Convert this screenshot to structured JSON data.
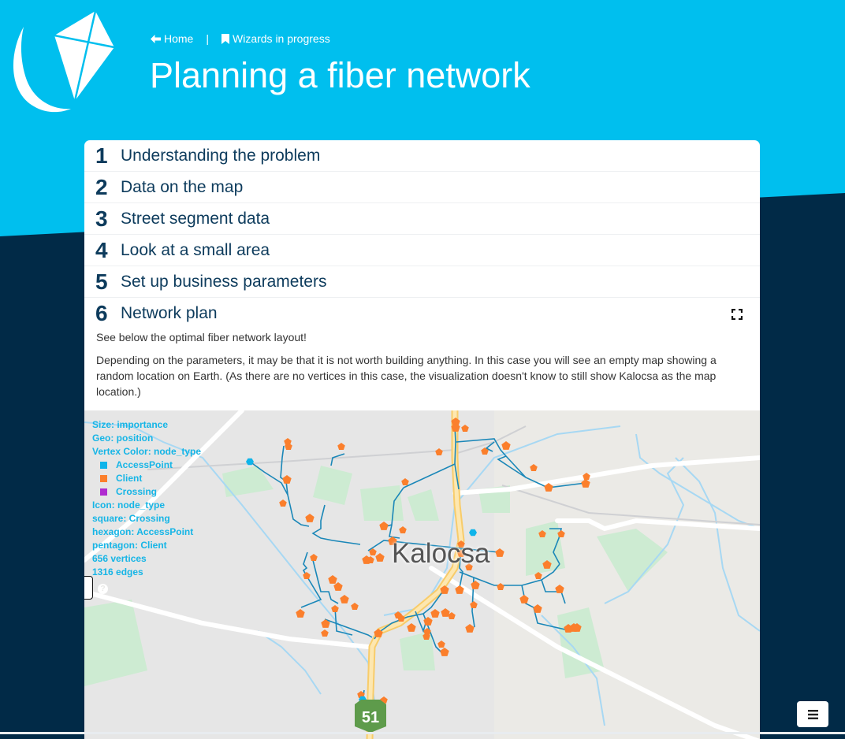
{
  "header": {
    "breadcrumb": {
      "home_label": "Home",
      "home_icon": "arrow-left-icon",
      "separator": "|",
      "wizards_label": "Wizards in progress",
      "wizards_icon": "bookmark-icon"
    },
    "title": "Planning a fiber network",
    "logo": "kite-logo"
  },
  "steps": [
    {
      "number": "1",
      "label": "Understanding the problem"
    },
    {
      "number": "2",
      "label": "Data on the map"
    },
    {
      "number": "3",
      "label": "Street segment data"
    },
    {
      "number": "4",
      "label": "Look at a small area"
    },
    {
      "number": "5",
      "label": "Set up business parameters"
    },
    {
      "number": "6",
      "label": "Network plan"
    }
  ],
  "active_step": {
    "fullscreen_icon": "fullscreen-icon",
    "intro": "See below the optimal fiber network layout!",
    "note": "Depending on the parameters, it may be that it is not worth building anything. In this case you will see an empty map showing a random location on Earth. (As there are no vertices in this case, the visualization doesn't know to still show Kalocsa as the map location.)"
  },
  "map": {
    "city_label": "Kalocsa",
    "road_shield": "51",
    "legend": {
      "size": "Size: importance",
      "geo": "Geo: position",
      "vertex_color": "Vertex Color: node_type",
      "colors": [
        {
          "label": "AccessPoint",
          "color": "#0fb4ea"
        },
        {
          "label": "Client",
          "color": "#fb7f2c"
        },
        {
          "label": "Crossing",
          "color": "#b02cd0"
        }
      ],
      "icon": "Icon: node_type",
      "square": "square: Crossing",
      "hexagon": "hexagon: AccessPoint",
      "pentagon": "pentagon: Client",
      "vertices": "656 vertices",
      "edges": "1316 edges"
    },
    "help_icon": "question-icon",
    "edge_color": "#1a87b8"
  },
  "menu_button": {
    "icon": "hamburger-menu-icon"
  }
}
